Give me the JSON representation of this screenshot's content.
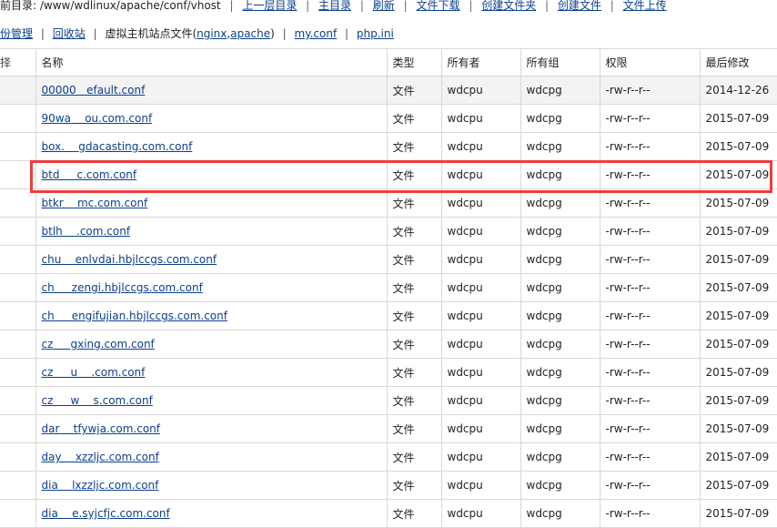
{
  "topbar": {
    "path_text": "前目录: /www/wdlinux/apache/conf/vhost",
    "links": [
      "上一层目录",
      "主目录",
      "刷新",
      "文件下载",
      "创建文件夹",
      "创建文件",
      "文件上传"
    ]
  },
  "subbar": {
    "backup_label": "份管理",
    "recycle_label": "回收站",
    "vhost_prefix": "虚拟主机站点文件(",
    "vhost_nginx": "nginx",
    "vhost_comma": ",",
    "vhost_apache": "apache",
    "vhost_suffix": ")",
    "myconf_label": "my.conf",
    "phpini_label": "php.ini",
    "separator": "|"
  },
  "table": {
    "headers": [
      "择",
      "名称",
      "类型",
      "所有者",
      "所有组",
      "权限",
      "最后修改"
    ],
    "rows": [
      {
        "sel": "",
        "name": "00000   efault.conf",
        "type": "文件",
        "owner": "wdcpu",
        "group": "wdcpg",
        "perm": "-rw-r--r--",
        "mtime": "2014-12-26"
      },
      {
        "sel": "",
        "name": "90wa    ou.com.conf",
        "type": "文件",
        "owner": "wdcpu",
        "group": "wdcpg",
        "perm": "-rw-r--r--",
        "mtime": "2015-07-09"
      },
      {
        "sel": "",
        "name": "box.    gdacasting.com.conf",
        "type": "文件",
        "owner": "wdcpu",
        "group": "wdcpg",
        "perm": "-rw-r--r--",
        "mtime": "2015-07-09"
      },
      {
        "sel": "",
        "name": "btd     c.com.conf",
        "type": "文件",
        "owner": "wdcpu",
        "group": "wdcpg",
        "perm": "-rw-r--r--",
        "mtime": "2015-07-09"
      },
      {
        "sel": "",
        "name": "btkr    mc.com.conf",
        "type": "文件",
        "owner": "wdcpu",
        "group": "wdcpg",
        "perm": "-rw-r--r--",
        "mtime": "2015-07-09"
      },
      {
        "sel": "",
        "name": "btlh    .com.conf",
        "type": "文件",
        "owner": "wdcpu",
        "group": "wdcpg",
        "perm": "-rw-r--r--",
        "mtime": "2015-07-09"
      },
      {
        "sel": "",
        "name": "chu    enlvdai.hbjlccgs.com.conf",
        "type": "文件",
        "owner": "wdcpu",
        "group": "wdcpg",
        "perm": "-rw-r--r--",
        "mtime": "2015-07-09"
      },
      {
        "sel": "",
        "name": "ch     zengi.hbjlccgs.com.conf",
        "type": "文件",
        "owner": "wdcpu",
        "group": "wdcpg",
        "perm": "-rw-r--r--",
        "mtime": "2015-07-09"
      },
      {
        "sel": "",
        "name": "ch     engifujian.hbjlccgs.com.conf",
        "type": "文件",
        "owner": "wdcpu",
        "group": "wdcpg",
        "perm": "-rw-r--r--",
        "mtime": "2015-07-09"
      },
      {
        "sel": "",
        "name": "cz     gxing.com.conf",
        "type": "文件",
        "owner": "wdcpu",
        "group": "wdcpg",
        "perm": "-rw-r--r--",
        "mtime": "2015-07-09"
      },
      {
        "sel": "",
        "name": "cz     u    .com.conf",
        "type": "文件",
        "owner": "wdcpu",
        "group": "wdcpg",
        "perm": "-rw-r--r--",
        "mtime": "2015-07-09"
      },
      {
        "sel": "",
        "name": "cz     w    s.com.conf",
        "type": "文件",
        "owner": "wdcpu",
        "group": "wdcpg",
        "perm": "-rw-r--r--",
        "mtime": "2015-07-09"
      },
      {
        "sel": "",
        "name": "dar    tfywja.com.conf",
        "type": "文件",
        "owner": "wdcpu",
        "group": "wdcpg",
        "perm": "-rw-r--r--",
        "mtime": "2015-07-09"
      },
      {
        "sel": "",
        "name": "day    xzzljc.com.conf",
        "type": "文件",
        "owner": "wdcpu",
        "group": "wdcpg",
        "perm": "-rw-r--r--",
        "mtime": "2015-07-09"
      },
      {
        "sel": "",
        "name": "dia    lxzzljc.com.conf",
        "type": "文件",
        "owner": "wdcpu",
        "group": "wdcpg",
        "perm": "-rw-r--r--",
        "mtime": "2015-07-09"
      },
      {
        "sel": "",
        "name": "dia    e.syjcfjc.com.conf",
        "type": "文件",
        "owner": "wdcpu",
        "group": "wdcpg",
        "perm": "-rw-r--r--",
        "mtime": "2015-07-09"
      }
    ]
  },
  "highlight_color": "#ee3c3c",
  "link_color": "#0b3f8f"
}
